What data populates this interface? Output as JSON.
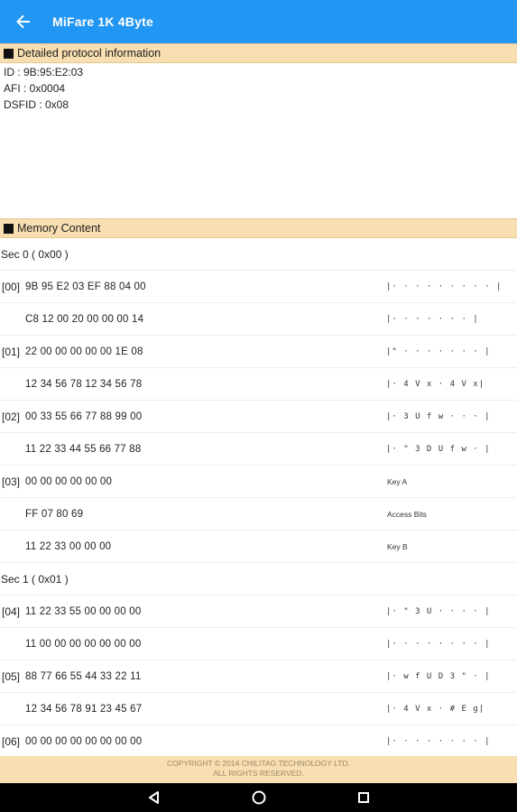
{
  "appbar": {
    "title": "MiFare 1K 4Byte",
    "back_icon": "arrow-left-icon"
  },
  "protocol": {
    "header": "Detailed protocol information",
    "lines": [
      "ID : 9B:95:E2:03",
      "AFI : 0x0004",
      "DSFID : 0x08"
    ]
  },
  "memory": {
    "header": "Memory Content",
    "sectors": [
      {
        "label": "Sec  0 ( 0x00 )",
        "rows": [
          {
            "addr": "[00]",
            "hex": "9B 95 E2 03 EF 88 04 00",
            "right": "|· · · · · · · · · |"
          },
          {
            "addr": "",
            "hex": "C8 12 00 20 00 00 00 14",
            "right": "|· · ·   · · · · |"
          },
          {
            "addr": "[01]",
            "hex": "22 00 00 00 00 00 1E 08",
            "right": "|\" · · · · · · · |"
          },
          {
            "addr": "",
            "hex": "12 34 56 78 12 34 56 78",
            "right": "|· 4 V x · 4 V x|"
          },
          {
            "addr": "[02]",
            "hex": "00 33 55 66 77 88 99 00",
            "right": "|· 3 U f w · · · |"
          },
          {
            "addr": "",
            "hex": "11 22 33 44 55 66 77 88",
            "right": "|· \" 3 D U f w · |"
          },
          {
            "addr": "[03]",
            "hex": "00 00 00 00 00 00",
            "right": "Key A"
          },
          {
            "addr": "",
            "hex": "FF 07 80 69",
            "right": "Access Bits"
          },
          {
            "addr": "",
            "hex": "11 22 33 00 00 00",
            "right": "Key B"
          }
        ]
      },
      {
        "label": "Sec  1 ( 0x01 )",
        "rows": [
          {
            "addr": "[04]",
            "hex": "11 22 33 55 00 00 00 00",
            "right": "|· \" 3 U · · · · |"
          },
          {
            "addr": "",
            "hex": "11 00 00 00 00 00 00 00",
            "right": "|· · · · · · · · |"
          },
          {
            "addr": "[05]",
            "hex": "88 77 66 55 44 33 22 11",
            "right": "|· w f U D 3 \" · |"
          },
          {
            "addr": "",
            "hex": "12 34 56 78 91 23 45 67",
            "right": "|· 4 V x · # E g|"
          },
          {
            "addr": "[06]",
            "hex": "00 00 00 00 00 00 00 00",
            "right": "|· · · · · · · · |"
          }
        ]
      }
    ]
  },
  "footer": {
    "line1": "COPYRIGHT © 2014 CHILITAG TECHNOLOGY LTD.",
    "line2": "ALL RIGHTS RESERVED."
  },
  "navbar": {
    "icons": [
      "back-triangle-icon",
      "home-circle-icon",
      "recents-square-icon"
    ]
  }
}
